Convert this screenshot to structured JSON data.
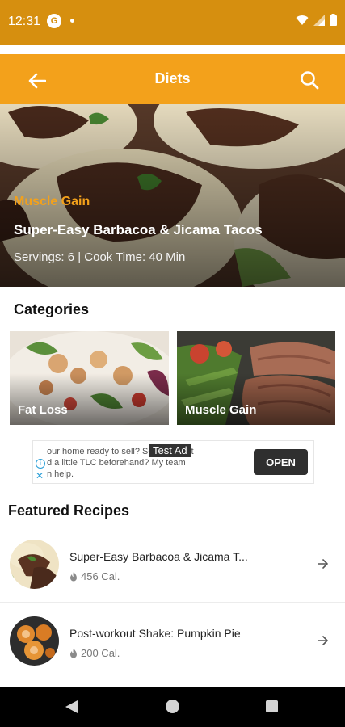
{
  "status_bar": {
    "time": "12:31",
    "app_icon": "G",
    "icons": [
      "notification-dot",
      "wifi-icon",
      "signal-icon",
      "battery-icon"
    ]
  },
  "app_bar": {
    "title": "Diets",
    "back_icon": "arrow-left-icon",
    "search_icon": "search-icon",
    "background_color": "#f3a11b"
  },
  "hero": {
    "category": "Muscle Gain",
    "title": "Super-Easy Barbacoa & Jicama Tacos",
    "meta": "Servings: 6 | Cook Time: 40 Min"
  },
  "categories": {
    "title": "Categories",
    "items": [
      {
        "label": "Fat Loss"
      },
      {
        "label": "Muscle Gain"
      }
    ]
  },
  "ad": {
    "label": "Test Ad",
    "text": "our home ready to sell? Sometimes it\nd a little TLC beforehand? My team\n​n help.",
    "button": "OPEN"
  },
  "featured": {
    "title": "Featured Recipes",
    "recipes": [
      {
        "name": "Super-Easy Barbacoa & Jicama T...",
        "calories": "456 Cal."
      },
      {
        "name": "Post-workout Shake: Pumpkin Pie",
        "calories": "200 Cal."
      }
    ]
  },
  "colors": {
    "status_bar": "#d68f0f",
    "accent": "#f3a11b"
  }
}
